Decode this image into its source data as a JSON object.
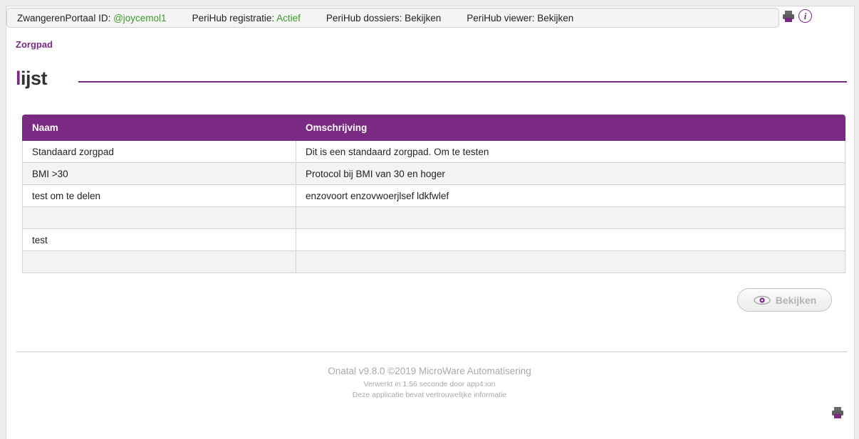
{
  "statusbar": {
    "portal_label": "ZwangerenPortaal ID: ",
    "portal_value": "@joycemol1",
    "registratie_label": "PeriHub registratie: ",
    "registratie_value": "Actief",
    "dossiers": "PeriHub dossiers: Bekijken",
    "viewer": "PeriHub viewer: Bekijken",
    "accent_green": "#3c9a2c"
  },
  "toolbar_icons": [
    "print-icon",
    "info-icon"
  ],
  "info_glyph": "i",
  "breadcrumb": "Zorgpad",
  "title": {
    "first_letter": "l",
    "rest": "ijst"
  },
  "brand_color": "#7b2a84",
  "table": {
    "columns": [
      "Naam",
      "Omschrijving"
    ],
    "rows": [
      [
        "Standaard zorgpad",
        "Dit is een standaard zorgpad. Om te testen"
      ],
      [
        "BMI >30",
        "Protocol bij BMI van 30 en hoger"
      ],
      [
        "test om te delen",
        "enzovoort enzovwoerjlsef ldkfwlef"
      ],
      [
        "",
        ""
      ],
      [
        "test",
        ""
      ],
      [
        "",
        ""
      ]
    ]
  },
  "view_button": {
    "label": "Bekijken",
    "icon": "eye-icon",
    "enabled": false
  },
  "footer": {
    "line1": "Onatal v9.8.0 ©2019 MicroWare Automatisering",
    "line2": "Verwerkt in 1.56 seconde door app4:ion",
    "line3": "Deze applicatie bevat vertrouwelijke informatie"
  }
}
